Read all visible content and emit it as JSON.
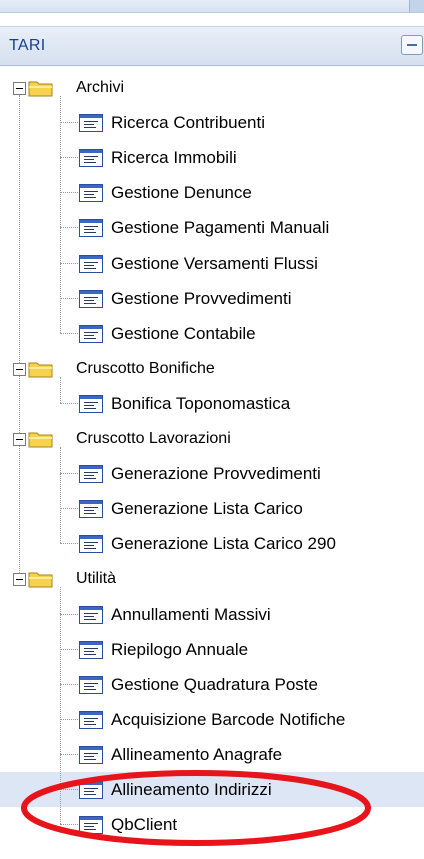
{
  "panel": {
    "title": "TARI"
  },
  "tree": [
    {
      "label": "Archivi",
      "children": [
        "Ricerca Contribuenti",
        "Ricerca Immobili",
        "Gestione Denunce",
        "Gestione Pagamenti Manuali",
        "Gestione Versamenti Flussi",
        "Gestione Provvedimenti",
        "Gestione Contabile"
      ]
    },
    {
      "label": "Cruscotto Bonifiche",
      "children": [
        "Bonifica Toponomastica"
      ]
    },
    {
      "label": "Cruscotto Lavorazioni",
      "children": [
        "Generazione Provvedimenti",
        "Generazione Lista Carico",
        "Generazione Lista Carico 290"
      ]
    },
    {
      "label": "Utilità",
      "children": [
        "Annullamenti Massivi",
        "Riepilogo Annuale",
        "Gestione Quadratura Poste",
        "Acquisizione Barcode Notifiche",
        "Allineamento Anagrafe",
        "Allineamento Indirizzi",
        "QbClient"
      ]
    }
  ],
  "selected_item": "Allineamento Indirizzi",
  "annotation": {
    "shape": "ellipse",
    "color": "#e8141c",
    "target": "Allineamento Indirizzi"
  },
  "colors": {
    "header_text": "#15428b",
    "selection": "#dce6f4",
    "folder": "#f6d24e",
    "doc_icon": "#3b66c2"
  }
}
